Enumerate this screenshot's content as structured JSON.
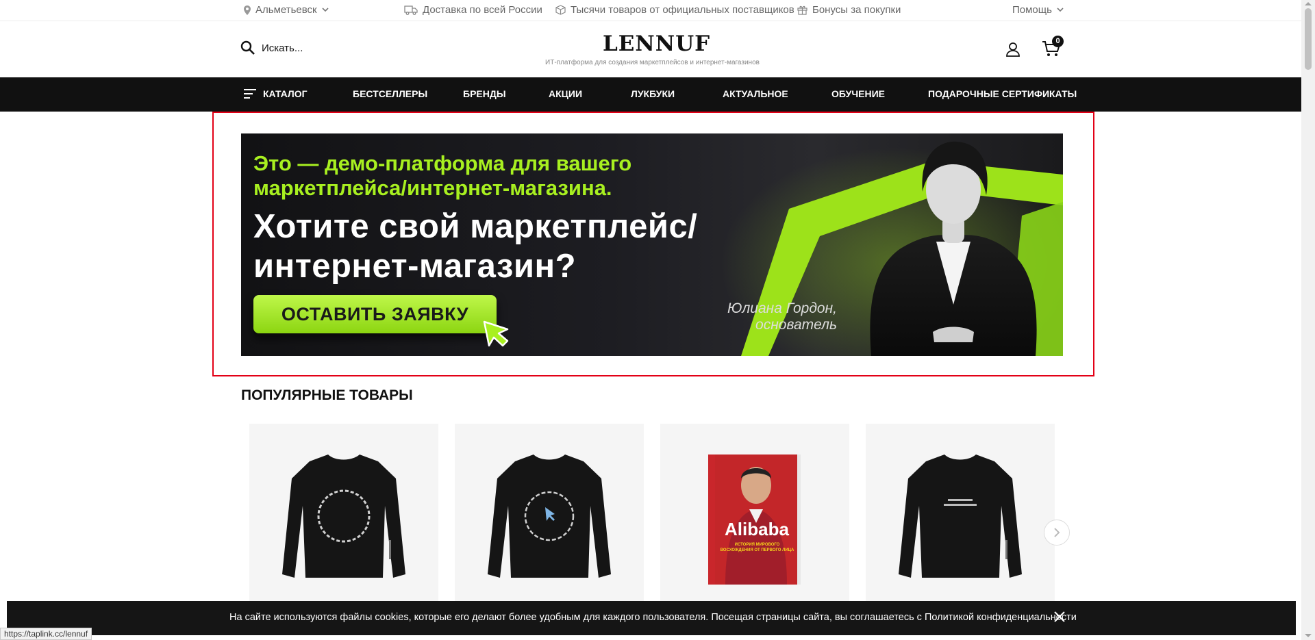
{
  "topbar": {
    "city": "Альметьевск",
    "delivery": "Доставка по всей России",
    "suppliers": "Тысячи товаров от официальных поставщиков",
    "bonuses": "Бонусы за покупки",
    "help": "Помощь"
  },
  "header": {
    "search_placeholder": "Искать...",
    "logo": "LENNUF",
    "tagline": "ИТ-платформа для создания маркетплейсов и интернет-магазинов",
    "cart_count": "0"
  },
  "nav": {
    "items": [
      "КАТАЛОГ",
      "БЕСТСЕЛЛЕРЫ",
      "БРЕНДЫ",
      "АКЦИИ",
      "ЛУКБУКИ",
      "АКТУАЛЬНОЕ",
      "ОБУЧЕНИЕ",
      "ПОДАРОЧНЫЕ СЕРТИФИКАТЫ"
    ]
  },
  "banner": {
    "line1a": "Это — демо-платформа для вашего",
    "line1b": "маркетплейса/интернет-магазина.",
    "line2a": "Хотите свой маркетплейс/",
    "line2b": "интернет-магазин?",
    "cta": "ОСТАВИТЬ ЗАЯВКУ",
    "sign_name": "Юлиана Гордон,",
    "sign_role": "основатель"
  },
  "popular": {
    "title": "ПОПУЛЯРНЫЕ ТОВАРЫ",
    "products": [
      {
        "image": "black-sweatshirt-circle-print"
      },
      {
        "image": "black-sweatshirt-just-marketplace-print"
      },
      {
        "image": "alibaba-book-cover",
        "cover_title": "Alibaba",
        "cover_subtitle": "ИСТОРИЯ МИРОВОГО ВОСХОЖДЕНИЯ ОТ ПЕРВОГО ЛИЦА"
      },
      {
        "image": "black-sweatshirt-text-print"
      }
    ]
  },
  "cookie": {
    "text": "На сайте используются файлы cookies, которые его делают более удобным для каждого пользователя. Посещая страницы сайта, вы соглашаетесь с Политикой конфиденциальности"
  },
  "status_url": "https://taplink.cc/lennuf",
  "colors": {
    "accent": "#a8f020",
    "nav_bg": "#111111",
    "highlight_frame": "#e30016"
  }
}
